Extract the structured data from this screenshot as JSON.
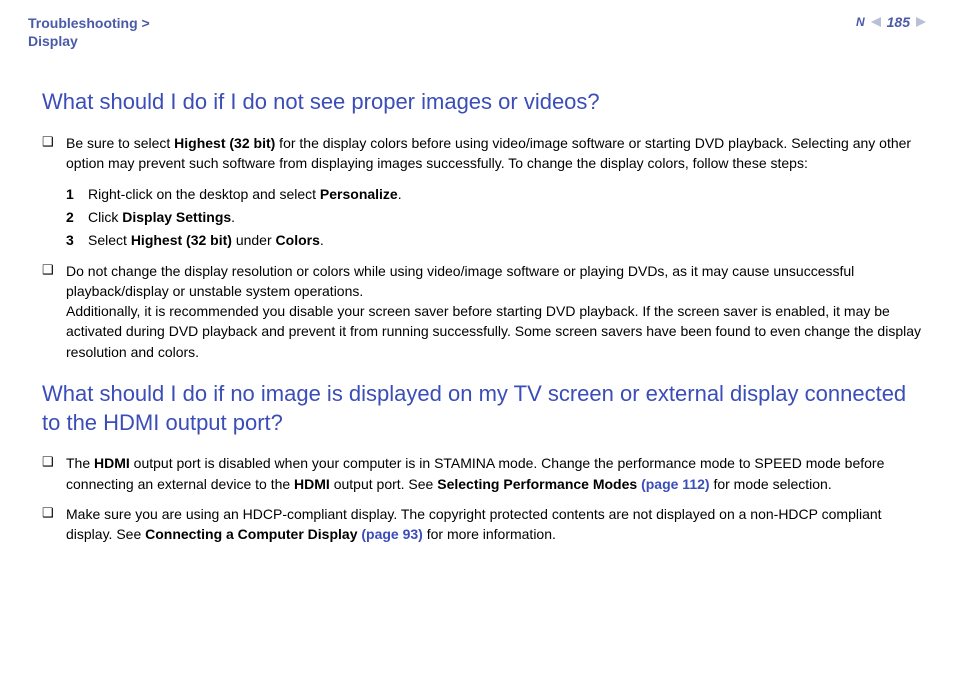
{
  "header": {
    "breadcrumb_line1": "Troubleshooting >",
    "breadcrumb_line2": "Display",
    "page_number": "185",
    "n_label": "N"
  },
  "sections": [
    {
      "heading": "What should I do if I do not see proper images or videos?",
      "bullets": [
        {
          "pre": "Be sure to select ",
          "bold1": "Highest (32 bit)",
          "post1": " for the display colors before using video/image software or starting DVD playback. Selecting any other option may prevent such software from displaying images successfully. To change the display colors, follow these steps:"
        },
        {
          "text": "Do not change the display resolution or colors while using video/image software or playing DVDs, as it may cause unsuccessful playback/display or unstable system operations.",
          "text2": "Additionally, it is recommended you disable your screen saver before starting DVD playback. If the screen saver is enabled, it may be activated during DVD playback and prevent it from running successfully. Some screen savers have been found to even change the display resolution and colors."
        }
      ],
      "steps": [
        {
          "num": "1",
          "pre": "Right-click on the desktop and select ",
          "bold": "Personalize",
          "post": "."
        },
        {
          "num": "2",
          "pre": "Click ",
          "bold": "Display Settings",
          "post": "."
        },
        {
          "num": "3",
          "pre": "Select ",
          "bold": "Highest (32 bit)",
          "mid": " under ",
          "bold2": "Colors",
          "post": "."
        }
      ]
    },
    {
      "heading": "What should I do if no image is displayed on my TV screen or external display connected to the HDMI output port?",
      "bullets": [
        {
          "pre": "The ",
          "bold1": "HDMI",
          "mid1": " output port is disabled when your computer is in STAMINA mode. Change the performance mode to SPEED mode before connecting an external device to the ",
          "bold2": "HDMI",
          "mid2": " output port. See ",
          "bold3": "Selecting Performance Modes ",
          "link": "(page 112)",
          "post": " for mode selection."
        },
        {
          "pre": "Make sure you are using an HDCP-compliant display. The copyright protected contents are not displayed on a non-HDCP compliant display. See ",
          "bold1": "Connecting a Computer Display ",
          "link": "(page 93)",
          "post": " for more information."
        }
      ]
    }
  ]
}
